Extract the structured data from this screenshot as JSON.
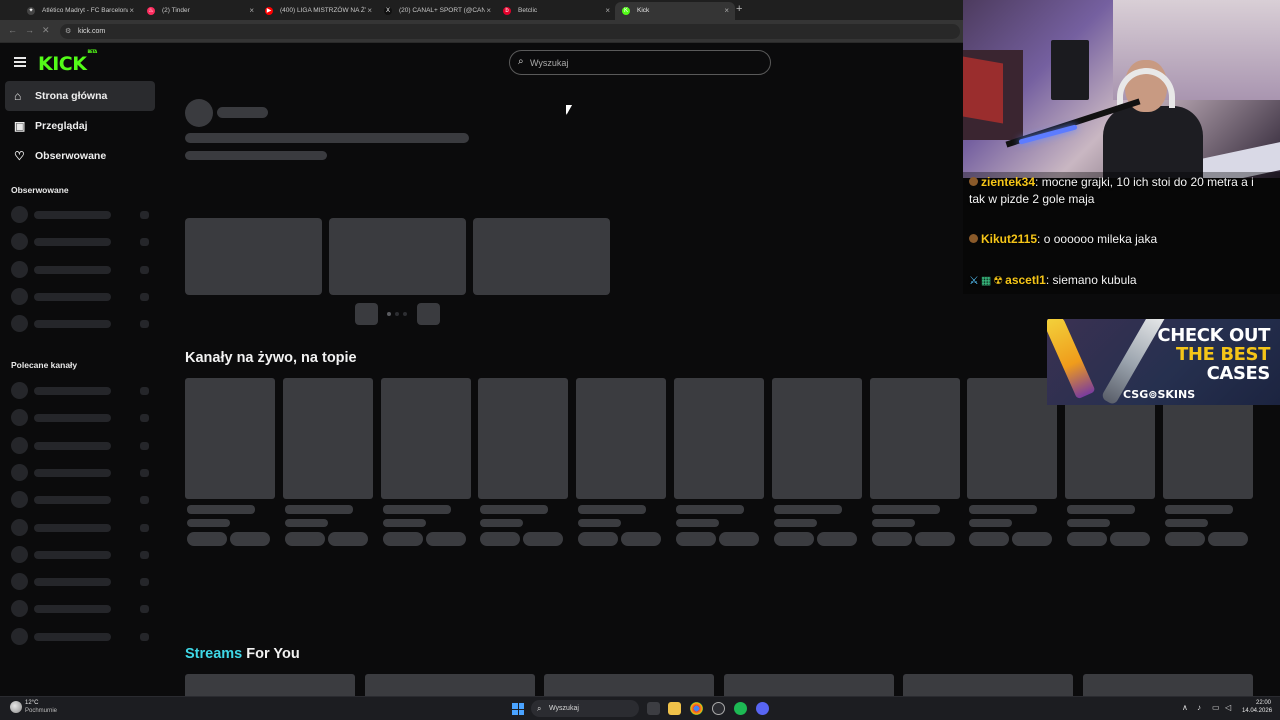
{
  "browser": {
    "tabs": [
      {
        "label": "Atlético Madryt - FC Barcelona",
        "favicon_color": "#444444",
        "favicon_glyph": "✦"
      },
      {
        "label": "(2) Tinder",
        "favicon_color": "#fd2d5f",
        "favicon_glyph": "♨"
      },
      {
        "label": "(400) LIGA MISTRZÓW NA ŻYWO",
        "favicon_color": "#ff0000",
        "favicon_glyph": "▶"
      },
      {
        "label": "(20) CANAL+ SPORT (@CANAL...",
        "favicon_color": "#111111",
        "favicon_glyph": "X"
      },
      {
        "label": "Betclic",
        "favicon_color": "#e4002b",
        "favicon_glyph": "b"
      },
      {
        "label": "Kick",
        "favicon_color": "#53fc18",
        "favicon_glyph": "K"
      }
    ],
    "active_tab_index": 5,
    "new_tab_symbol": "+",
    "close_symbol": "×",
    "url": "kick.com"
  },
  "kick": {
    "logo_text": "KICK",
    "logo_badge": "BETA",
    "brand_color": "#53fc18",
    "search_placeholder": "Wyszukaj",
    "nav": [
      {
        "label": "Strona główna",
        "icon": "home-icon",
        "glyph": "⌂"
      },
      {
        "label": "Przeglądaj",
        "icon": "browse-icon",
        "glyph": "▣"
      },
      {
        "label": "Obserwowane",
        "icon": "heart-icon",
        "glyph": "♡"
      }
    ],
    "followed_heading": "Obserwowane",
    "recommended_heading": "Polecane kanały",
    "live_section_title": "Kanały na żywo, na topie",
    "streams_title_accent": "Streams",
    "streams_title_rest": "For You"
  },
  "chat": {
    "messages": [
      {
        "user": "zientek34",
        "text": "mocne grajki, 10 ich stoi do 20 metra a i tak w pizde 2 gole maja",
        "user_color": "#f5c518"
      },
      {
        "user": "Kikut2115",
        "text": "o oooooo mileka jaka",
        "user_color": "#f5c518"
      },
      {
        "user": "ascetI1",
        "text": "siemano kubula",
        "user_color": "#f5c518"
      }
    ]
  },
  "ad": {
    "line1": "CHECK OUT",
    "line2": "THE BEST",
    "line3": "CASES",
    "brand": "CSG⊚SKINS"
  },
  "taskbar": {
    "temperature": "12°C",
    "condition": "Pochmurnie",
    "search_label": "Wyszukaj",
    "time": "22:00",
    "date": "14.04.2026"
  }
}
